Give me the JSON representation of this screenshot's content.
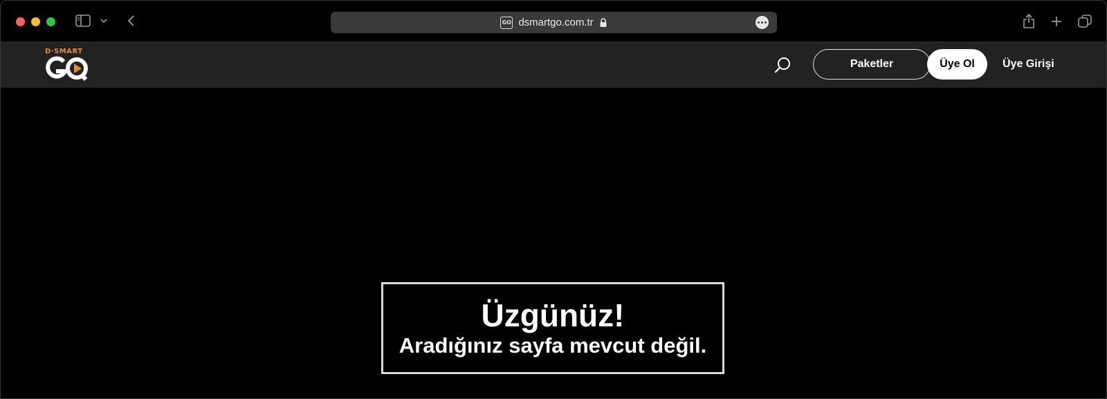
{
  "browser": {
    "url": "dsmartgo.com.tr",
    "favicon_text": "GO"
  },
  "site": {
    "logo": {
      "top_text": "D·SMART",
      "main_text": "GO"
    },
    "nav": {
      "packages_label": "Paketler",
      "signup_label": "Üye Ol",
      "login_label": "Üye Girişi"
    },
    "colors": {
      "brand_orange": "#f08a24",
      "header_bg": "#222222"
    }
  },
  "error": {
    "title": "Üzgünüz!",
    "subtitle": "Aradığınız sayfa mevcut değil."
  }
}
